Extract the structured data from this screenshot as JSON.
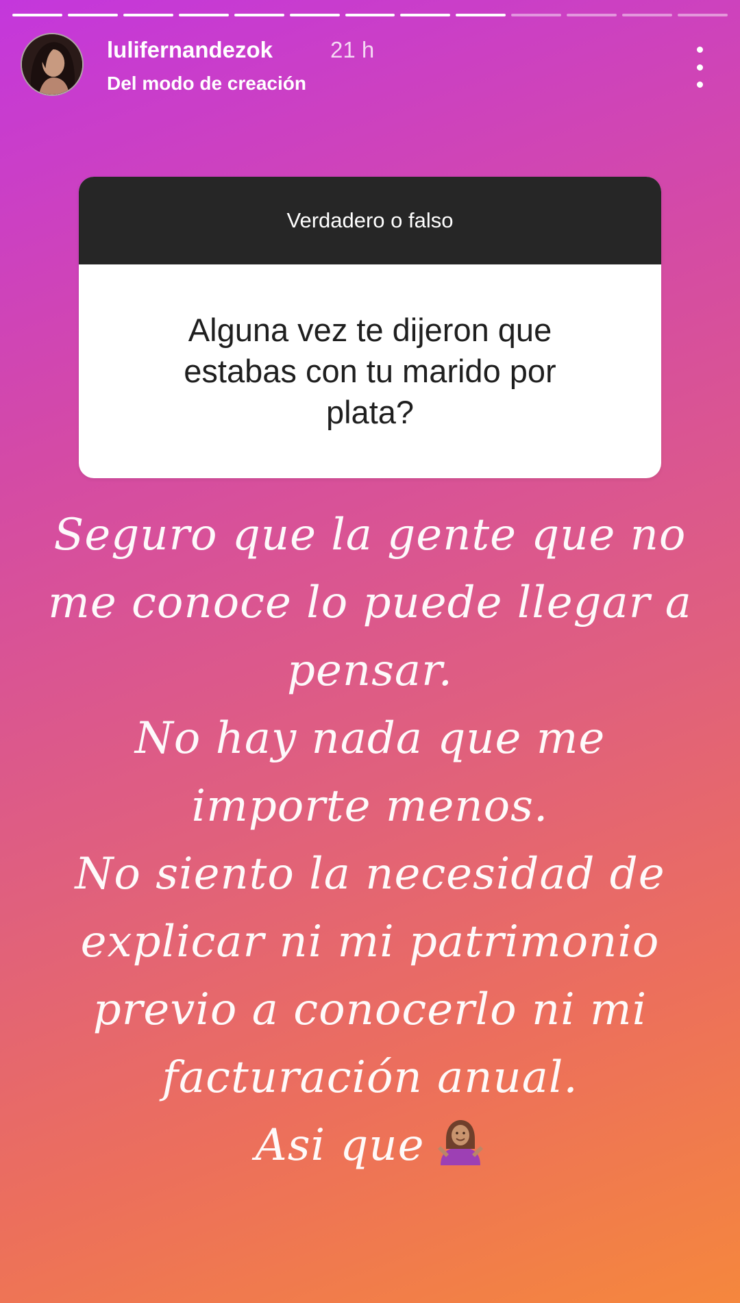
{
  "story": {
    "progress": [
      1,
      1,
      1,
      1,
      1,
      1,
      1,
      1,
      1,
      0,
      0,
      0,
      0
    ],
    "username": "lulifernandezok",
    "time_ago": "21 h",
    "subtitle": "Del modo de creación"
  },
  "question_card": {
    "header": "Verdadero o falso",
    "question": "Alguna vez te dijeron que estabas con tu marido por plata?"
  },
  "answer": {
    "lines": [
      "Seguro que la gente que no",
      "me conoce lo puede llegar a",
      "pensar.",
      "No hay nada que me",
      "importe menos.",
      "No siento la necesidad de",
      "explicar ni mi patrimonio",
      "previo a conocerlo ni mi",
      "facturación anual.",
      "Asi que"
    ],
    "emoji": "person-shrugging-emoji"
  },
  "icons": {
    "more": "more-vertical-icon"
  }
}
